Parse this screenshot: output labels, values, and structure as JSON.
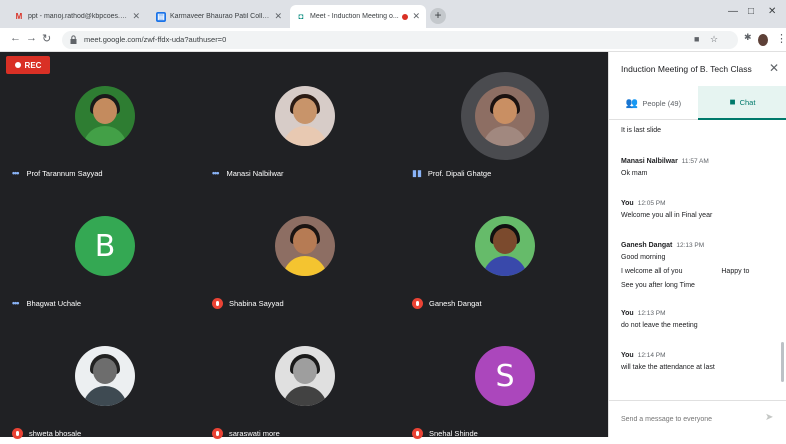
{
  "browser": {
    "tabs": [
      {
        "label": "ppt - manoj.rathod@kbpcoes.e...",
        "icon": "gmail-icon"
      },
      {
        "label": "Karmaveer Bhaurao Patil College...",
        "icon": "college-site-icon"
      },
      {
        "label": "Meet - Induction Meeting o...",
        "icon": "meet-icon"
      }
    ],
    "new_tab": "+",
    "url": "meet.google.com/zwf-ffdx-uda?authuser=0",
    "window_controls": {
      "minimize": "—",
      "maximize": "□",
      "close": "✕"
    }
  },
  "meet": {
    "rec_label": "REC",
    "participants": [
      {
        "name": "Prof Tarannum Sayyad",
        "mic": "dots",
        "avatar": "photo",
        "bg": "#2e7d32",
        "skin": "#c48b5e",
        "hair": "#1a1a1a",
        "shirt": "#43a047"
      },
      {
        "name": "Manasi Nalbilwar",
        "mic": "dots",
        "avatar": "photo",
        "bg": "#d7ccc8",
        "skin": "#c8946a",
        "hair": "#2b1b14",
        "shirt": "#e8c9b2"
      },
      {
        "name": "Prof. Dipali Ghatge",
        "mic": "active",
        "avatar": "photo",
        "speaking": true,
        "bg": "#8d6e63",
        "skin": "#c98f63",
        "hair": "#1b1210",
        "shirt": "#a1887f"
      },
      {
        "name": "Bhagwat Uchale",
        "mic": "dots",
        "avatar": "letter",
        "letter": "B",
        "bg": "#34a853"
      },
      {
        "name": "Shabina Sayyad",
        "mic": "off",
        "avatar": "photo",
        "bg": "#8d6e63",
        "skin": "#b67b54",
        "hair": "#1a1412",
        "shirt": "#f4c430"
      },
      {
        "name": "Ganesh Dangat",
        "mic": "off",
        "avatar": "photo",
        "bg": "#66bb6a",
        "skin": "#7b4a2d",
        "hair": "#111111",
        "shirt": "#3949ab"
      },
      {
        "name": "shweta bhosale",
        "mic": "off",
        "avatar": "photo",
        "bg": "#eceff1",
        "skin": "#6d6d6d",
        "hair": "#222222",
        "shirt": "#3e4a52"
      },
      {
        "name": "saraswati more",
        "mic": "off",
        "avatar": "photo",
        "bg": "#e0e0e0",
        "skin": "#9e9e9e",
        "hair": "#1a1a1a",
        "shirt": "#424242"
      },
      {
        "name": "Snehal Shinde",
        "mic": "off",
        "avatar": "letter",
        "letter": "S",
        "bg": "#ab47bc"
      }
    ]
  },
  "panel": {
    "title": "Induction Meeting of B. Tech Class",
    "close": "✕",
    "tabs": {
      "people": "People (49)",
      "chat": "Chat"
    },
    "messages": [
      {
        "sender": "",
        "time": "",
        "lines": [
          "It is last slide"
        ]
      },
      {
        "sender": "Manasi Nalbilwar",
        "time": "11:57 AM",
        "lines": [
          "Ok mam"
        ]
      },
      {
        "sender": "You",
        "time": "12:05 PM",
        "lines": [
          "Welcome you all in Final year"
        ]
      },
      {
        "sender": "Ganesh Dangat",
        "time": "12:13 PM",
        "lines": [
          "Good morning",
          "I welcome all of you                    Happy to",
          "See you after long Time"
        ]
      },
      {
        "sender": "You",
        "time": "12:13 PM",
        "lines": [
          "do not leave the meeting"
        ]
      },
      {
        "sender": "You",
        "time": "12:14 PM",
        "lines": [
          "will take the attendance at last"
        ]
      }
    ],
    "compose_placeholder": "Send a message to everyone",
    "send": "➤"
  },
  "colors": {
    "meet_bg": "#202124",
    "accent": "#00796b",
    "rec": "#d93025"
  }
}
